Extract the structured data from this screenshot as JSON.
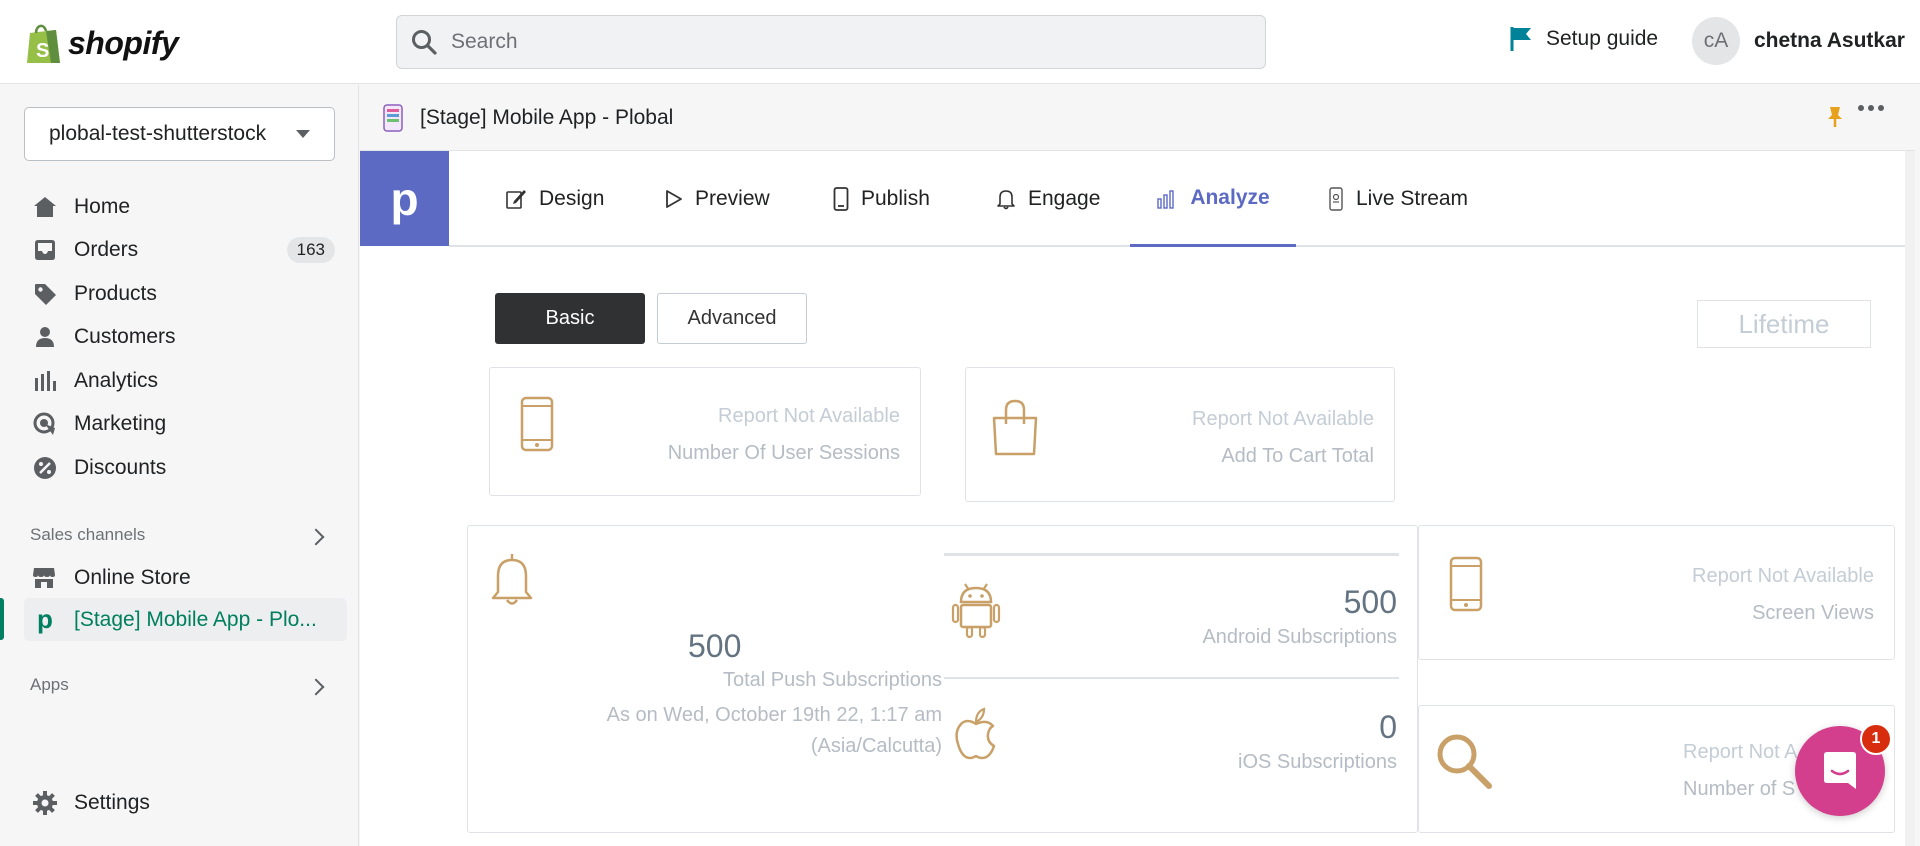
{
  "brand": {
    "logo_text": "shopify",
    "accent": "#008060"
  },
  "search": {
    "placeholder": "Search"
  },
  "header": {
    "setup_guide": "Setup guide",
    "avatar_initials": "cA",
    "user_name": "chetna Asutkar"
  },
  "sidebar": {
    "store": "plobal-test-shutterstock",
    "items": [
      {
        "label": "Home",
        "icon": "home-icon"
      },
      {
        "label": "Orders",
        "icon": "orders-icon",
        "badge": "163"
      },
      {
        "label": "Products",
        "icon": "tag-icon"
      },
      {
        "label": "Customers",
        "icon": "person-icon"
      },
      {
        "label": "Analytics",
        "icon": "bar-chart-icon"
      },
      {
        "label": "Marketing",
        "icon": "target-icon"
      },
      {
        "label": "Discounts",
        "icon": "discount-icon"
      }
    ],
    "sales_channels_label": "Sales channels",
    "channels": [
      {
        "label": "Online Store",
        "icon": "store-icon"
      },
      {
        "label": "[Stage] Mobile App - Plo...",
        "icon": "plobal-icon",
        "active": true
      }
    ],
    "apps_label": "Apps",
    "settings_label": "Settings"
  },
  "app": {
    "title": "[Stage] Mobile App - Plobal",
    "logo_letter": "p",
    "brand_color": "#5c6ac4",
    "tabs": [
      {
        "label": "Design",
        "icon": "design-icon"
      },
      {
        "label": "Preview",
        "icon": "play-icon"
      },
      {
        "label": "Publish",
        "icon": "phone-icon"
      },
      {
        "label": "Engage",
        "icon": "bell-icon"
      },
      {
        "label": "Analyze",
        "icon": "analyze-icon",
        "active": true
      },
      {
        "label": "Live Stream",
        "icon": "livestream-icon"
      }
    ],
    "segments": {
      "basic": "Basic",
      "advanced": "Advanced",
      "selected": "Basic"
    },
    "period": "Lifetime"
  },
  "cards": {
    "sessions": {
      "status": "Report Not Available",
      "label": "Number Of User Sessions"
    },
    "cart": {
      "status": "Report Not Available",
      "label": "Add To Cart Total"
    },
    "screen_views": {
      "status": "Report Not Available",
      "label": "Screen Views"
    },
    "search": {
      "status": "Report Not A",
      "label": "Number of S"
    },
    "push": {
      "total": "500",
      "total_label": "Total Push Subscriptions",
      "as_on": "As on Wed, October 19th 22, 1:17 am",
      "timezone": "(Asia/Calcutta)",
      "android": "500",
      "android_label": "Android Subscriptions",
      "ios": "0",
      "ios_label": "iOS Subscriptions"
    }
  },
  "chat": {
    "badge": "1"
  }
}
